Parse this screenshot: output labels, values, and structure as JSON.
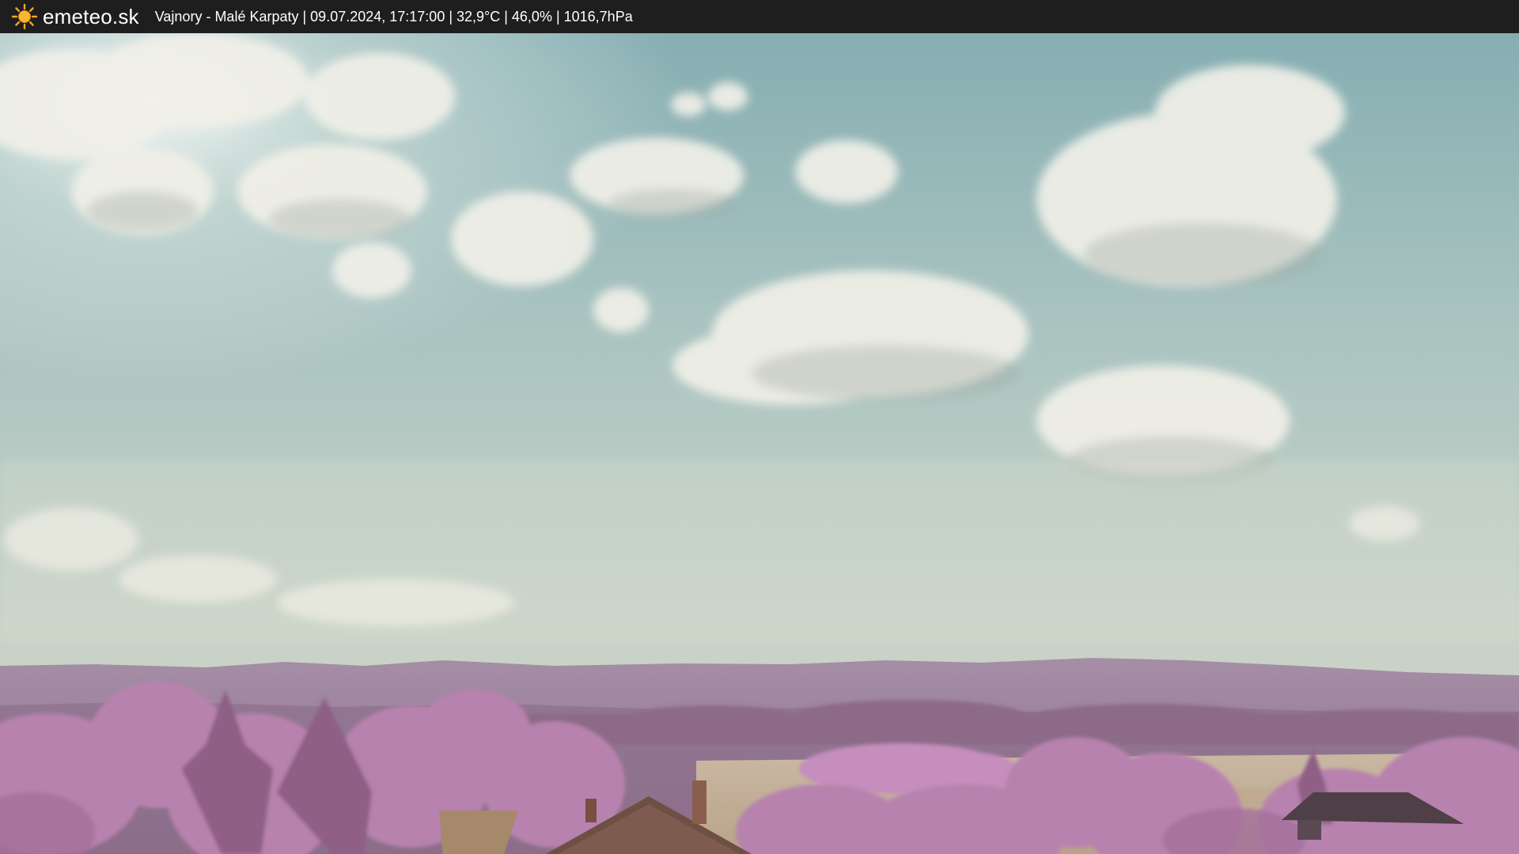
{
  "header": {
    "brand_icon": "sun-icon",
    "brand_name": "emeteo.sk",
    "caption": "Vajnory - Malé Karpaty | 09.07.2024, 17:17:00 | 32,9°C | 46,0% | 1016,7hPa"
  },
  "colors": {
    "bar_background": "#1e1e1e",
    "sun": "#f5a623",
    "sky_top": "#8fb3b4",
    "sky_horizon": "#c9d3c8",
    "hills": "#9a7f98",
    "foliage": "#c493bd",
    "field": "#c8b49a"
  }
}
